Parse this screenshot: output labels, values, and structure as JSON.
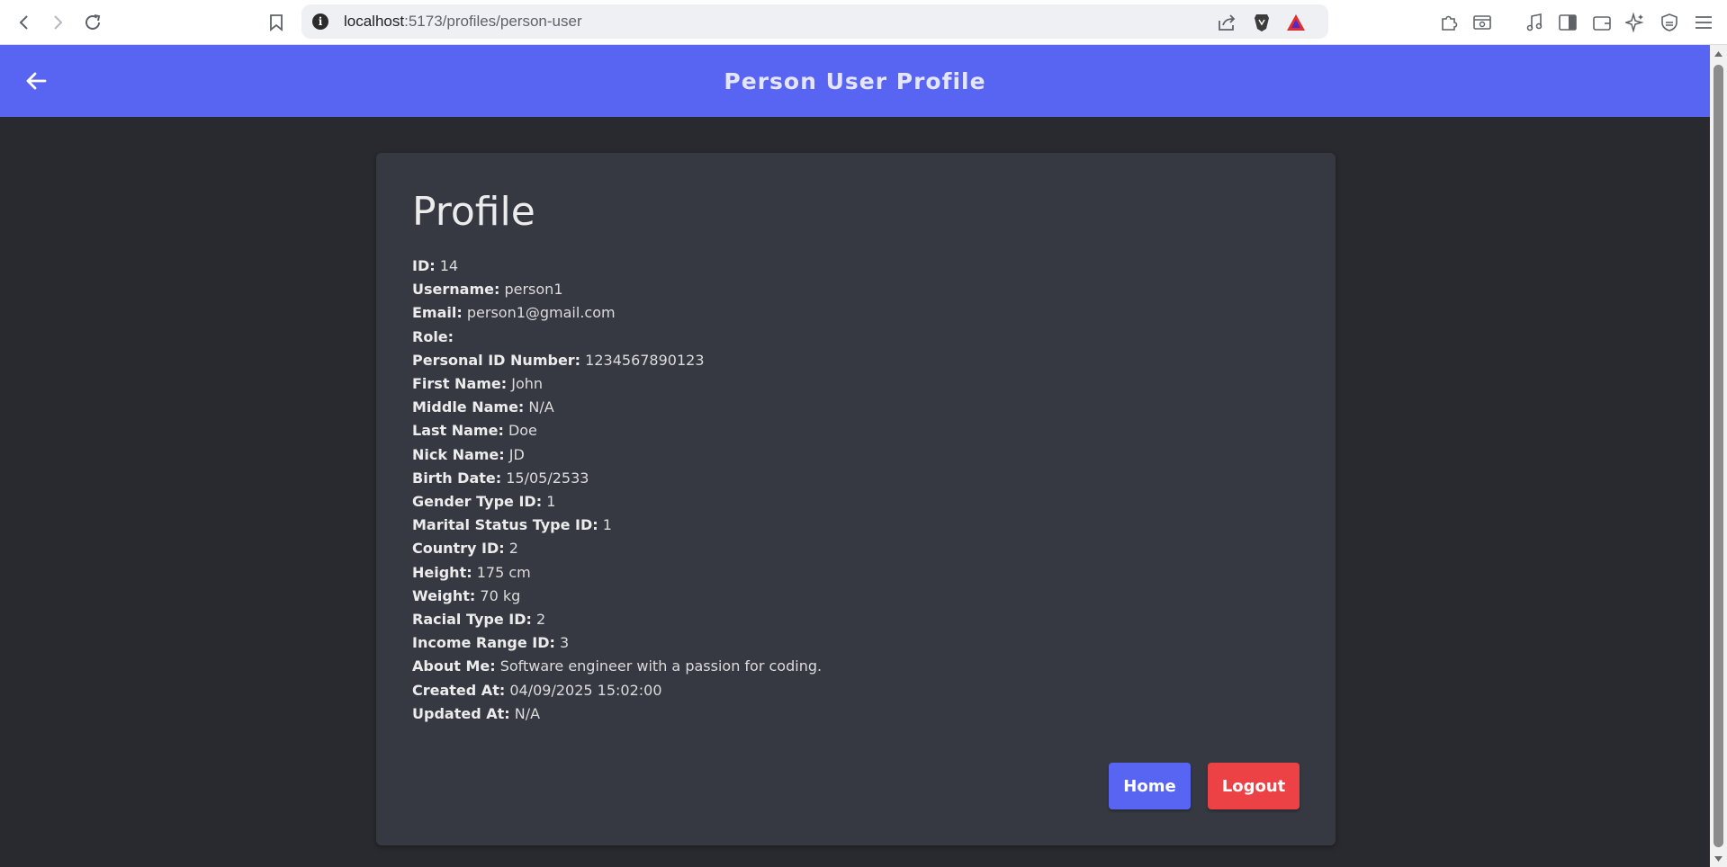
{
  "browser": {
    "url_host": "localhost",
    "url_path": ":5173/profiles/person-user"
  },
  "header": {
    "title": "Person User Profile"
  },
  "profile": {
    "heading": "Profile",
    "fields": [
      {
        "label": "ID:",
        "value": "14"
      },
      {
        "label": "Username:",
        "value": "person1"
      },
      {
        "label": "Email:",
        "value": "person1@gmail.com"
      },
      {
        "label": "Role:",
        "value": ""
      },
      {
        "label": "Personal ID Number:",
        "value": "1234567890123"
      },
      {
        "label": "First Name:",
        "value": "John"
      },
      {
        "label": "Middle Name:",
        "value": "N/A"
      },
      {
        "label": "Last Name:",
        "value": "Doe"
      },
      {
        "label": "Nick Name:",
        "value": "JD"
      },
      {
        "label": "Birth Date:",
        "value": "15/05/2533"
      },
      {
        "label": "Gender Type ID:",
        "value": "1"
      },
      {
        "label": "Marital Status Type ID:",
        "value": "1"
      },
      {
        "label": "Country ID:",
        "value": "2"
      },
      {
        "label": "Height:",
        "value": "175 cm"
      },
      {
        "label": "Weight:",
        "value": "70 kg"
      },
      {
        "label": "Racial Type ID:",
        "value": "2"
      },
      {
        "label": "Income Range ID:",
        "value": "3"
      },
      {
        "label": "About Me:",
        "value": "Software engineer with a passion for coding."
      },
      {
        "label": "Created At:",
        "value": "04/09/2025 15:02:00"
      },
      {
        "label": "Updated At:",
        "value": "N/A"
      }
    ],
    "home_label": "Home",
    "logout_label": "Logout"
  },
  "colors": {
    "header_bg": "#5865f2",
    "page_bg": "#282a2f",
    "card_bg": "#363942",
    "home_btn": "#5865f2",
    "logout_btn": "#ed4245"
  },
  "icons": {
    "back": "arrow-left-icon",
    "browser_back": "chevron-left-icon",
    "browser_forward": "chevron-right-icon",
    "reload": "reload-icon",
    "bookmark": "bookmark-icon",
    "info": "info-icon",
    "share": "share-icon",
    "brave": "brave-shield-icon",
    "rewards": "brave-rewards-icon",
    "extensions": "puzzle-icon",
    "search-page": "search-page-icon",
    "media": "music-note-icon",
    "sidebar": "sidebar-icon",
    "wallet": "wallet-icon",
    "leo": "sparkle-icon",
    "vpn": "vpn-shield-icon",
    "menu": "hamburger-menu-icon"
  }
}
